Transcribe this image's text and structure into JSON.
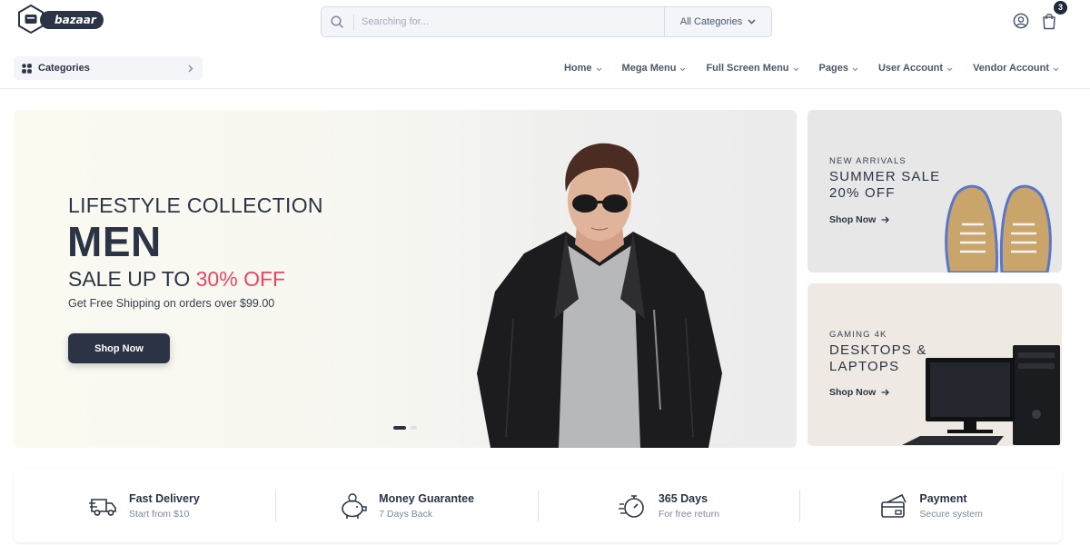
{
  "header": {
    "logo_text": "bazaar",
    "search": {
      "placeholder": "Searching for...",
      "category_label": "All Categories"
    },
    "cart_count": "3"
  },
  "nav": {
    "categories_label": "Categories",
    "items": [
      "Home",
      "Mega Menu",
      "Full Screen Menu",
      "Pages",
      "User Account",
      "Vendor Account"
    ]
  },
  "hero": {
    "eyebrow": "LIFESTYLE COLLECTION",
    "title": "MEN",
    "sale_prefix": "SALE UP TO ",
    "sale_accent": "30% OFF",
    "description": "Get Free Shipping on orders over $99.00",
    "button_label": "Shop Now",
    "slide_count": 2,
    "active_slide": 1
  },
  "promos": [
    {
      "eyebrow": "NEW ARRIVALS",
      "title": "SUMMER SALE 20% OFF",
      "link": "Shop Now"
    },
    {
      "eyebrow": "GAMING 4K",
      "title": "DESKTOPS & LAPTOPS",
      "link": "Shop Now"
    }
  ],
  "services": [
    {
      "icon": "truck-icon",
      "title": "Fast Delivery",
      "subtitle": "Start from $10"
    },
    {
      "icon": "piggy-bank-icon",
      "title": "Money Guarantee",
      "subtitle": "7 Days Back"
    },
    {
      "icon": "stopwatch-icon",
      "title": "365 Days",
      "subtitle": "For free return"
    },
    {
      "icon": "credit-card-icon",
      "title": "Payment",
      "subtitle": "Secure system"
    }
  ],
  "colors": {
    "primary": "#2b3445",
    "accent": "#e94560",
    "muted": "#7d879c"
  }
}
